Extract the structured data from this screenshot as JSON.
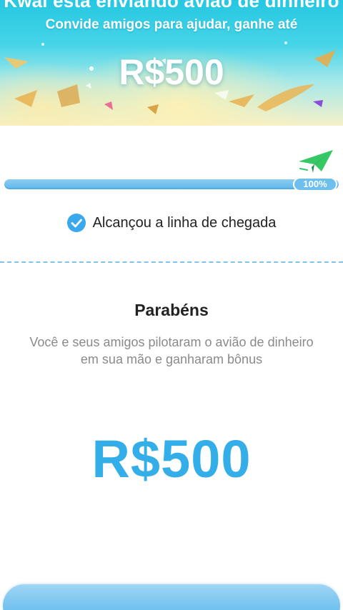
{
  "banner": {
    "scroll_title": "Kwai está enviando avião de dinheiro",
    "subtitle": "Convide amigos para ajudar, ganhe até",
    "amount": "R$500"
  },
  "progress": {
    "value_percent": 100,
    "badge_label": "100%"
  },
  "status": {
    "text": "Alcançou a linha de chegada",
    "icon": "check-circle-icon"
  },
  "congrats": {
    "title": "Parabéns",
    "description": "Você e seus amigos pilotaram o avião de dinheiro em sua mão e ganharam bônus",
    "amount": "R$500"
  },
  "colors": {
    "accent": "#33aee9",
    "progress_fill": "#5eb7ea",
    "divider": "#7dc4ee",
    "plane": "#37c866"
  }
}
